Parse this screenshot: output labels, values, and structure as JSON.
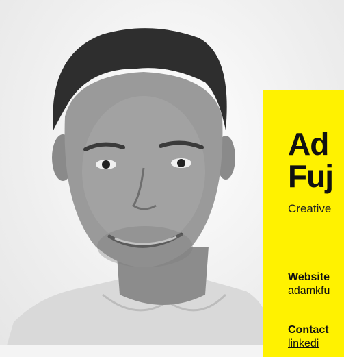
{
  "profile": {
    "name_line1": "Ad",
    "name_line2": "Fuj",
    "role": "Creative",
    "website_label": "Website",
    "website_link": "adamkfu",
    "contact_label": "Contact",
    "contact_link": "linkedi"
  },
  "colors": {
    "card_background": "#fff200",
    "text": "#111111"
  },
  "photo": {
    "subject": "headshot-portrait",
    "style": "black-and-white"
  }
}
